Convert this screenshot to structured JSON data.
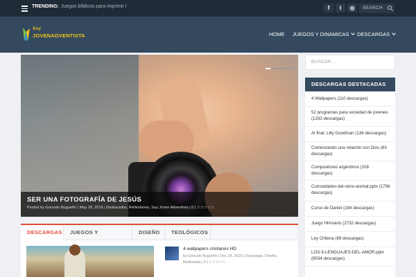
{
  "topbar": {
    "trending_label": "TRENDING:",
    "trending_text": "Juegos bíblicos para imprimir i",
    "social": [
      {
        "icon": "facebook-icon",
        "glyph": "f"
      },
      {
        "icon": "twitter-icon",
        "glyph": "t"
      },
      {
        "icon": "instagram-icon",
        "glyph": "◎"
      }
    ],
    "search_placeholder": "SEARCH"
  },
  "header": {
    "logo_line1": "Soy",
    "logo_line2": "JOVENADVENTISTA",
    "nav": [
      "HOME",
      "JUEGOS Y DINAMICAS",
      "DESCARGAS"
    ],
    "colors": {
      "header_bg": "#34495e",
      "topbar_bg": "#1e2a36",
      "logo": "#f5c518"
    }
  },
  "slider": {
    "title": "SER UNA FOTOGRAFÍA DE JESÚS",
    "meta": "Posted by Gonzalo Bugueño | May 28, 2016 | Destacados, Reflexiones, Soy Joven Adventista | 0 | ☆☆☆☆☆"
  },
  "tabs": {
    "items": [
      "DESCARGAS",
      "JUEGOS Y DINAMICAS",
      "DISEÑO",
      "TEOLÓGICOS"
    ],
    "accent": "#e04a3a",
    "post_title": "4 wallpapers cristianos HD",
    "post_meta": "by Gonzalo Bugueño | Dec 28, 2015 | Descargas, Diseño, Multimedia | 0 | ☆☆☆☆☆"
  },
  "sidebar": {
    "search_placeholder": "BUSCAR ...",
    "widget_title": "DESCARGAS DESTACADAS",
    "items": [
      "4 Wallpapers (110 descargas)",
      "52 programas para sociedad de jovenes (1333 descargas)",
      "Al final. Lilly Goodman (136 descargas)",
      "Comenzando una relación con Dios (83 descargas)",
      "Compositores argentinos (108 descargas)",
      "Curiosidades-del-reino-animal.pptx (1756 descargas)",
      "Curso de Daniel (184 descargas)",
      "Juego Himnario (2732 descargas)",
      "Ley Chilena (69 descargas)",
      "LOS-5-LENGUAJES-DEL-AMOR.pptx (6534 descargas)"
    ]
  }
}
